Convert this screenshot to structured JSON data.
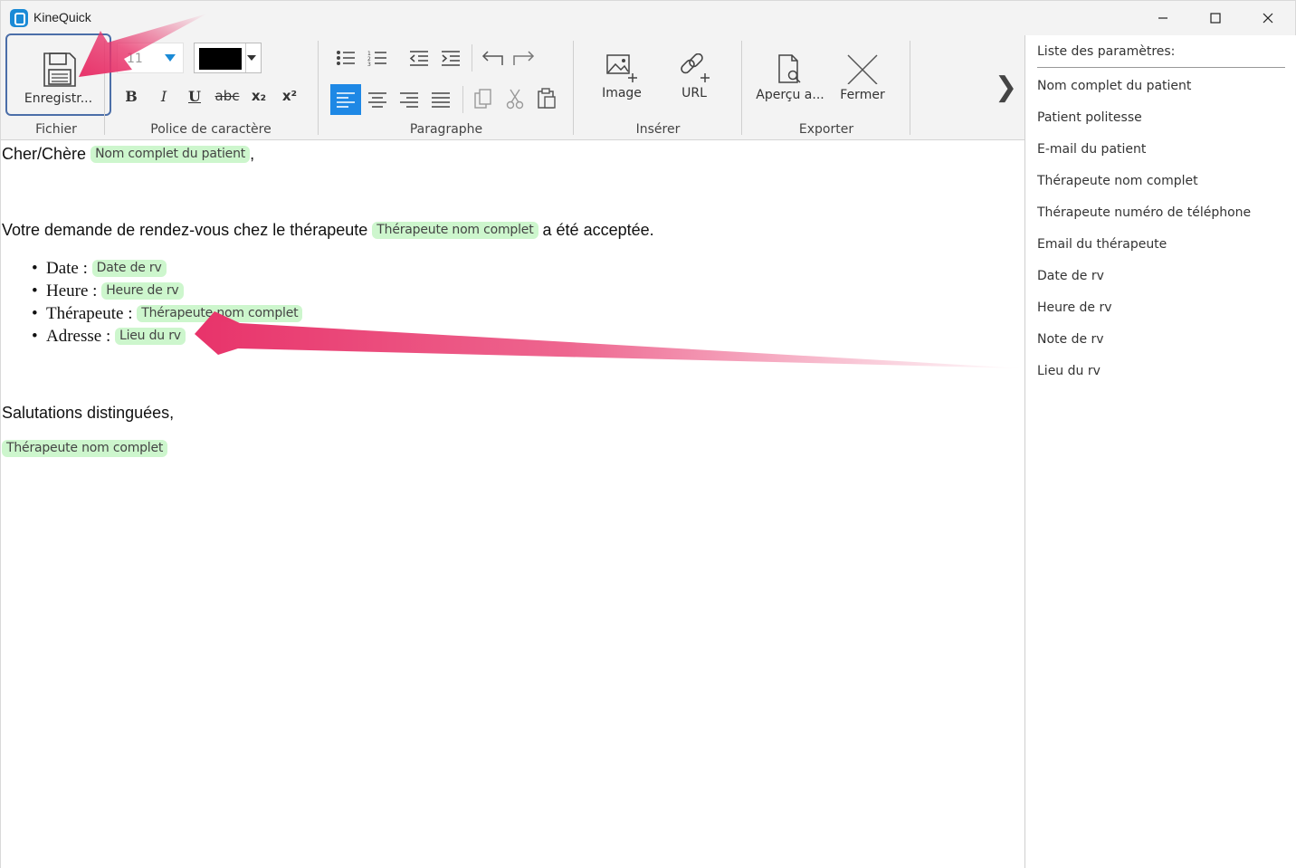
{
  "app": {
    "title": "KineQuick"
  },
  "window_controls": {
    "minimize": "—",
    "maximize": "☐",
    "close": "✕"
  },
  "ribbon": {
    "file": {
      "save_label": "Enregistr...",
      "group_label": "Fichier"
    },
    "font": {
      "size_value": "11",
      "color": "#000000",
      "group_label": "Police de caractère",
      "bold": "B",
      "italic": "I",
      "underline": "U",
      "strike": "abc",
      "subscript": "x₂",
      "superscript": "x²"
    },
    "paragraph": {
      "group_label": "Paragraphe"
    },
    "insert": {
      "image_label": "Image",
      "url_label": "URL",
      "group_label": "Insérer"
    },
    "export": {
      "preview_label": "Aperçu a...",
      "close_label": "Fermer",
      "group_label": "Exporter"
    },
    "more": "❯"
  },
  "document": {
    "greeting": "Cher/Chère",
    "greeting_tag": "Nom complet du patient",
    "greeting_end": ",",
    "line2_before": "Votre demande de rendez-vous chez le thérapeute",
    "line2_tag": "Thérapeute nom complet",
    "line2_after": "a été acceptée.",
    "items": [
      {
        "label": "Date :",
        "tag": "Date de rv"
      },
      {
        "label": "Heure :",
        "tag": "Heure de rv"
      },
      {
        "label": "Thérapeute :",
        "tag": "Thérapeute nom complet"
      },
      {
        "label": "Adresse :",
        "tag": "Lieu du rv"
      }
    ],
    "closing": "Salutations distinguées,",
    "signature_tag": "Thérapeute nom complet"
  },
  "panel": {
    "title": "Liste des paramètres:",
    "params": [
      "Nom complet du patient",
      "Patient politesse",
      "E-mail du patient",
      "Thérapeute nom complet",
      "Thérapeute numéro de téléphone",
      "Email du thérapeute",
      "Date de rv",
      "Heure de rv",
      "Note de rv",
      "Lieu du rv"
    ]
  },
  "colors": {
    "accent": "#1e88e5",
    "tag_bg": "#cdf6cd",
    "annotation": "#e8336a",
    "save_border": "#4b6ea8"
  }
}
